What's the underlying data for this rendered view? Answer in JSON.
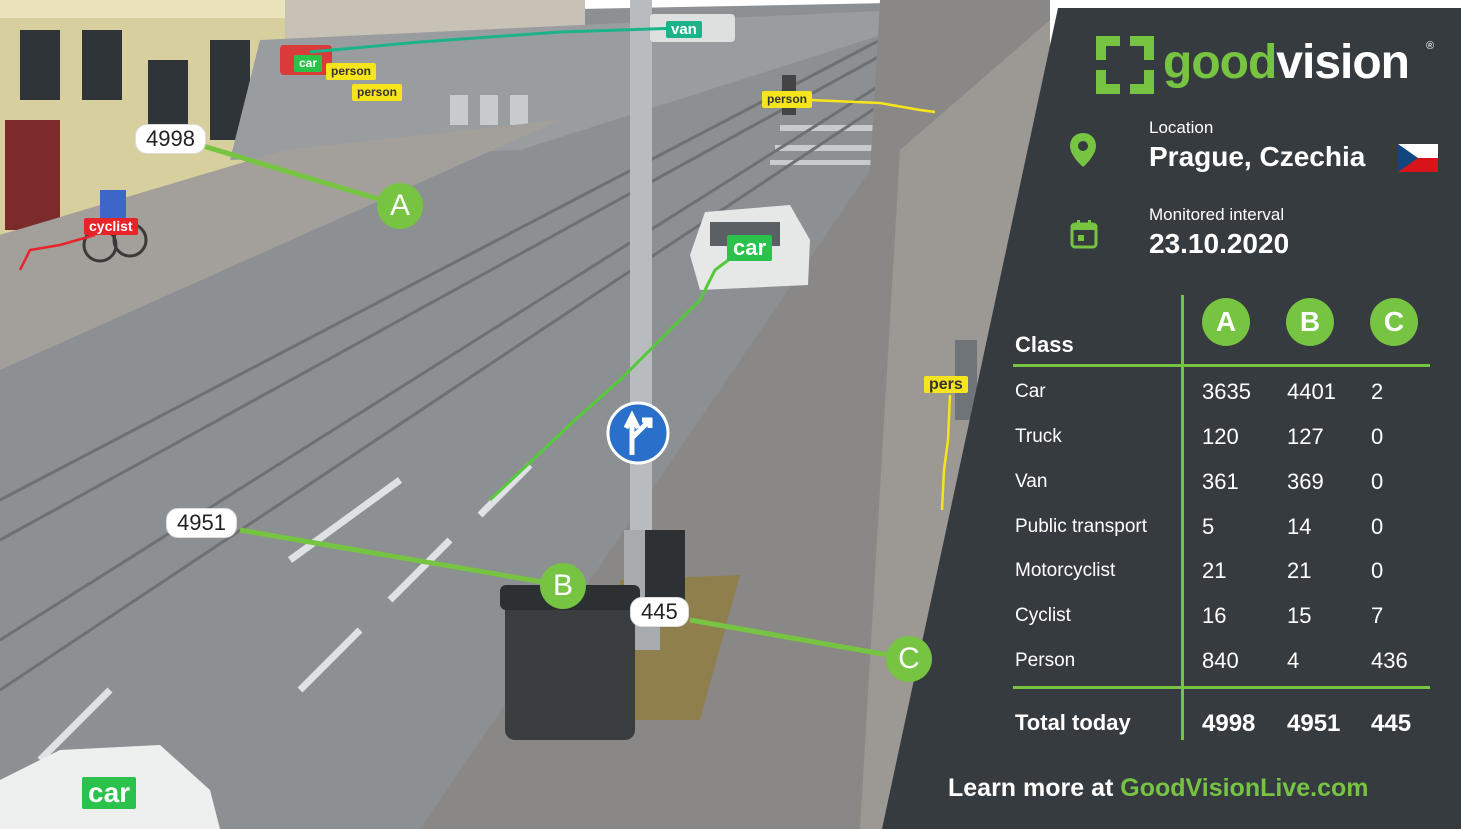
{
  "brand": {
    "good": "good",
    "vision": "vision",
    "registered": "®",
    "color": "#76c442"
  },
  "location": {
    "label": "Location",
    "value": "Prague, Czechia"
  },
  "interval": {
    "label": "Monitored interval",
    "value": "23.10.2020"
  },
  "table": {
    "class_header": "Class",
    "columns": [
      "A",
      "B",
      "C"
    ],
    "rows": [
      {
        "label": "Car",
        "values": [
          "3635",
          "4401",
          "2"
        ]
      },
      {
        "label": "Truck",
        "values": [
          "120",
          "127",
          "0"
        ]
      },
      {
        "label": "Van",
        "values": [
          "361",
          "369",
          "0"
        ]
      },
      {
        "label": "Public transport",
        "values": [
          "5",
          "14",
          "0"
        ]
      },
      {
        "label": "Motorcyclist",
        "values": [
          "21",
          "21",
          "0"
        ]
      },
      {
        "label": "Cyclist",
        "values": [
          "16",
          "15",
          "7"
        ]
      },
      {
        "label": "Person",
        "values": [
          "840",
          "4",
          "436"
        ]
      }
    ],
    "total_label": "Total today",
    "totals": [
      "4998",
      "4951",
      "445"
    ]
  },
  "footer": {
    "prefix": "Learn more at ",
    "link": "GoodVisionLive.com"
  },
  "scene": {
    "counts": {
      "a": "4998",
      "b": "4951",
      "c": "445"
    },
    "markers": {
      "a": "A",
      "b": "B",
      "c": "C"
    },
    "tags": {
      "car_top": "car",
      "person_1": "person",
      "person_2": "person",
      "person_3": "person",
      "van": "van",
      "cyclist": "cyclist",
      "car_mid": "car",
      "car_bottom": "car",
      "person_right": "pers"
    }
  }
}
